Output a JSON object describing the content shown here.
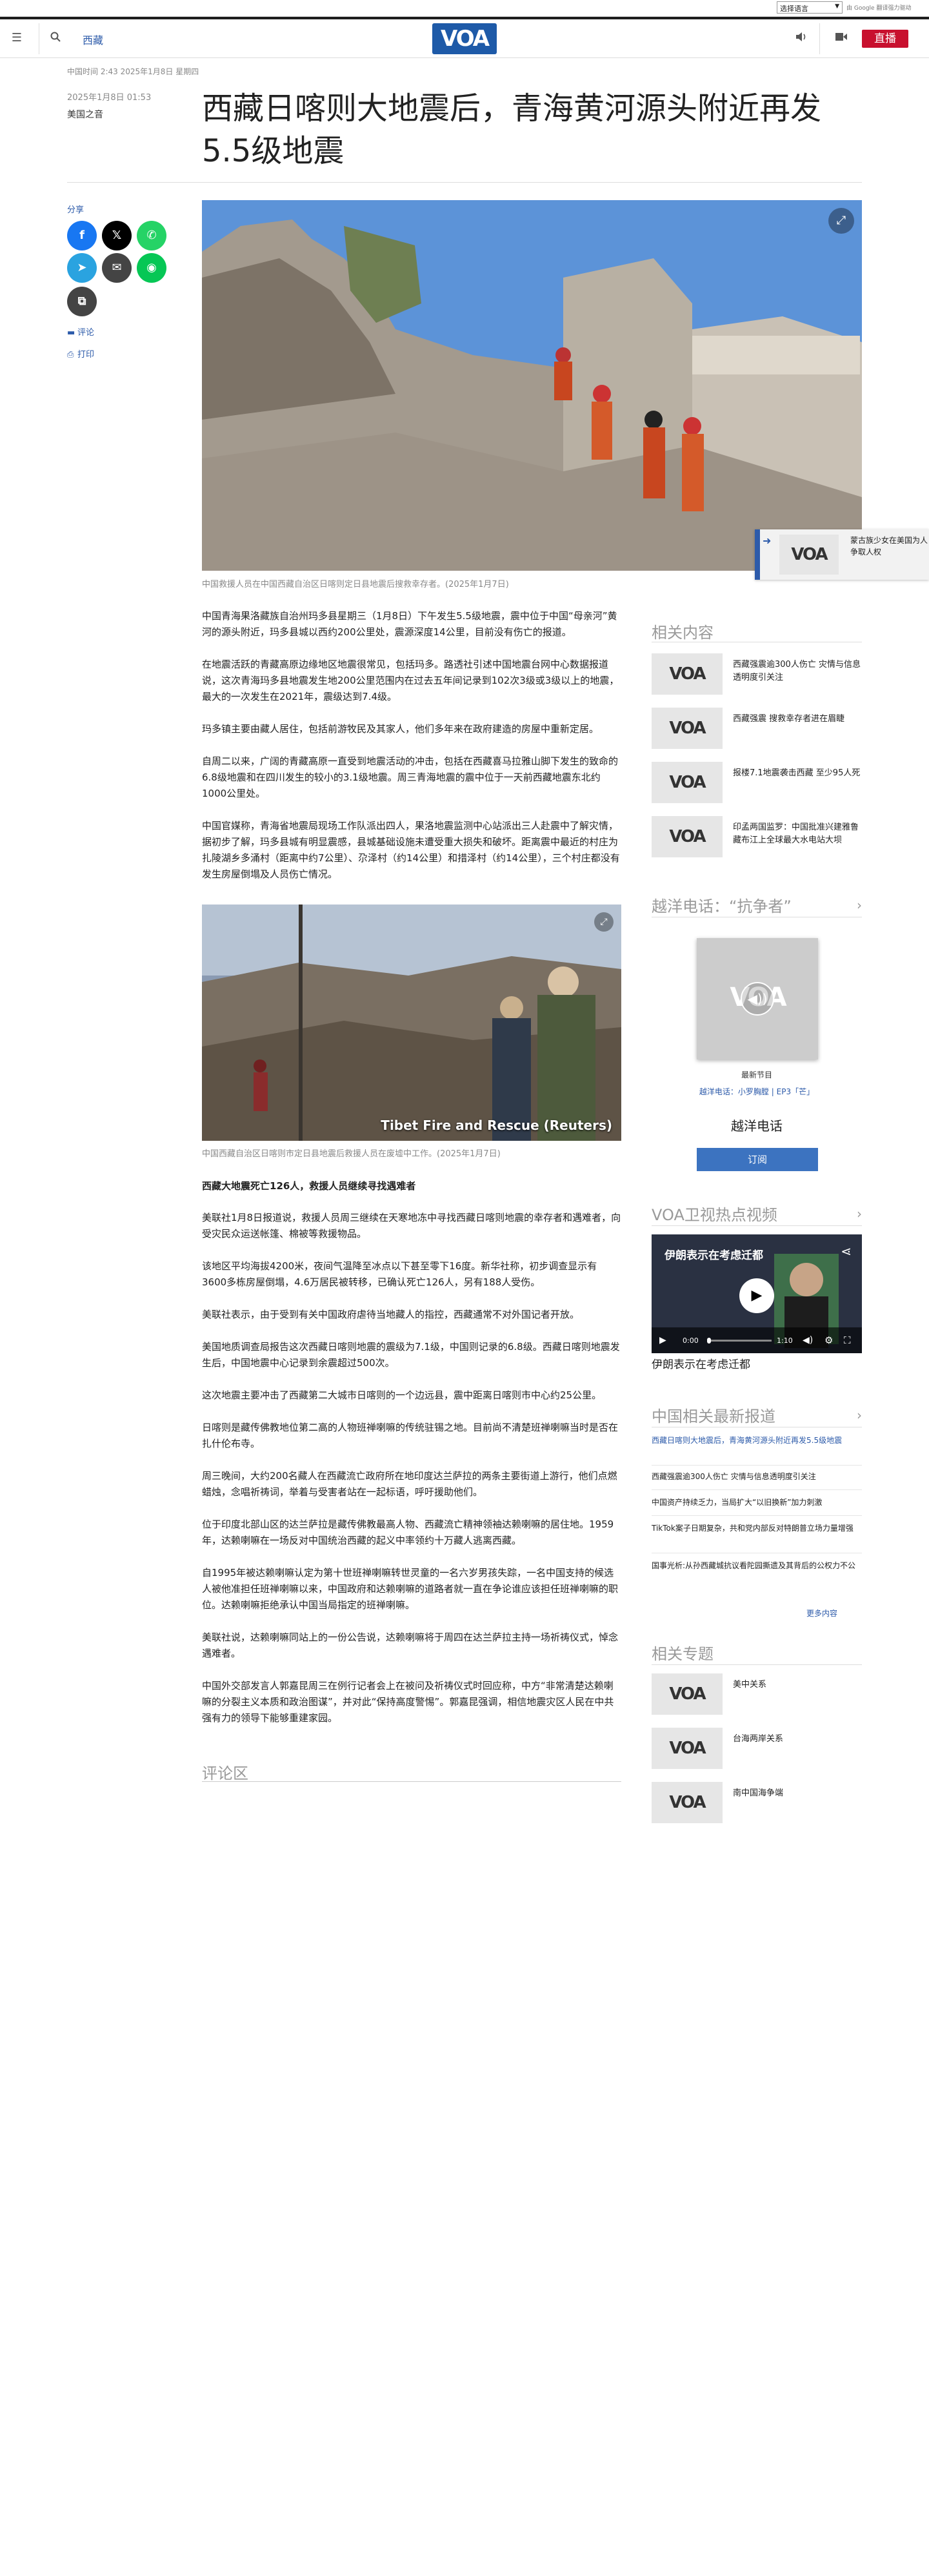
{
  "top": {
    "language_select": "选择语言",
    "google_translate": "由 Google 翻译强力驱动"
  },
  "header": {
    "section": "西藏",
    "logo": "VOA",
    "live": "直播"
  },
  "article": {
    "meta": "中国时间 2:43 2025年1月8日 星期四",
    "date": "2025年1月8日 01:53",
    "byline": "美国之音",
    "title": "西藏日喀则大地震后，青海黄河源头附近再发5.5级地震",
    "share_label": "分享",
    "comments_link": "评论",
    "print_link": "打印",
    "hero_caption": "中国救援人员在中国西藏自治区日喀则定日县地震后搜救幸存者。(2025年1月7日)",
    "paras1": [
      "中国青海果洛藏族自治州玛多县星期三（1月8日）下午发生5.5级地震，震中位于中国“母亲河”黄河的源头附近，玛多县城以西约200公里处，震源深度14公里，目前没有伤亡的报道。",
      "在地震活跃的青藏高原边缘地区地震很常见，包括玛多。路透社引述中国地震台网中心数据报道说，这次青海玛多县地震发生地200公里范围内在过去五年间记录到102次3级或3级以上的地震，最大的一次发生在2021年，震级达到7.4级。",
      "玛多镇主要由藏人居住，包括前游牧民及其家人，他们多年来在政府建造的房屋中重新定居。",
      "自周二以来，广阔的青藏高原一直受到地震活动的冲击，包括在西藏喜马拉雅山脚下发生的致命的6.8级地震和在四川发生的较小的3.1级地震。周三青海地震的震中位于一天前西藏地震东北约1000公里处。",
      "中国官媒称，青海省地震局现场工作队派出四人，果洛地震监测中心站派出三人赴震中了解灾情，据初步了解，玛多县城有明显震感，县城基础设施未遭受重大损失和破坏。距离震中最近的村庄为扎陵湖乡多涌村（距离中约7公里）、尕泽村（约14公里）和措泽村（约14公里），三个村庄都没有发生房屋倒塌及人员伤亡情况。"
    ],
    "img2_caption": "中国西藏自治区日喀则市定日县地震后救援人员在废墟中工作。(2025年1月7日)",
    "img2_overlay": "Tibet Fire and Rescue (Reuters)",
    "subhead": "西藏大地震死亡126人，救援人员继续寻找遇难者",
    "paras2": [
      "美联社1月8日报道说，救援人员周三继续在天寒地冻中寻找西藏日喀则地震的幸存者和遇难者，向受灾民众运送帐篷、棉被等救援物品。",
      "该地区平均海拔4200米，夜间气温降至冰点以下甚至零下16度。新华社称，初步调查显示有3600多栋房屋倒塌，4.6万居民被转移，已确认死亡126人，另有188人受伤。",
      "美联社表示，由于受到有关中国政府虐待当地藏人的指控，西藏通常不对外国记者开放。",
      "美国地质调查局报告这次西藏日喀则地震的震级为7.1级，中国则记录的6.8级。西藏日喀则地震发生后，中国地震中心记录到余震超过500次。",
      "这次地震主要冲击了西藏第二大城市日喀则的一个边远县，震中距离日喀则市中心约25公里。",
      "日喀则是藏传佛教地位第二高的人物班禅喇嘛的传统驻锡之地。目前尚不清楚班禅喇嘛当时是否在扎什伦布寺。",
      "周三晚间，大约200名藏人在西藏流亡政府所在地印度达兰萨拉的两条主要街道上游行，他们点燃蜡烛，念唱祈祷词，举着与受害者站在一起标语，呼吁援助他们。",
      "位于印度北部山区的达兰萨拉是藏传佛教最高人物、西藏流亡精神领袖达赖喇嘛的居住地。1959年，达赖喇嘛在一场反对中国统治西藏的起义中率领约十万藏人逃离西藏。",
      "自1995年被达赖喇嘛认定为第十世班禅喇嘛转世灵童的一名六岁男孩失踪，一名中国支持的候选人被他准担任班禅喇嘛以来，中国政府和达赖喇嘛的道路者就一直在争论谁应该担任班禅喇嘛的职位。达赖喇嘛拒绝承认中国当局指定的班禅喇嘛。",
      "美联社说，达赖喇嘛同站上的一份公告说，达赖喇嘛将于周四在达兰萨拉主持一场祈祷仪式，悼念遇难者。",
      "中国外交部发言人郭嘉昆周三在例行记者会上在被问及祈祷仪式时回应称，中方“非常清楚达赖喇嘛的分裂主义本质和政治图谋”，并对此“保持高度警惕”。郭嘉昆强调，相信地震灾区人民在中共强有力的领导下能够重建家园。"
    ],
    "comments_heading": "评论区"
  },
  "float": {
    "title": "蒙古族少女在美国为人争取人权"
  },
  "sidebar": {
    "related_heading": "相关内容",
    "related": [
      {
        "title": "西藏强震逾300人伤亡 灾情与信息透明度引关注"
      },
      {
        "title": "西藏强震 搜救幸存者进在眉睫"
      },
      {
        "title": "报楼7.1地震袭击西藏 至少95人死"
      },
      {
        "title": "印孟两国监罗：中国批准兴建雅鲁藏布江上全球最大水电站大坝"
      }
    ],
    "radio_heading": "越洋电话：“抗争者”",
    "radio_latest": "最新节目",
    "radio_episode_prefix": "越洋电话：小罗胸膛",
    "radio_episode_sep": "|",
    "radio_episode": "EP3「芒」",
    "radio_name": "越洋电话",
    "subscribe": "订阅",
    "video_heading": "VOA卫视热点视频",
    "video_title": "伊朗表示在考虑迁都",
    "video_time_start": "0:00",
    "video_time_end": "1:10",
    "video_caption": "伊朗表示在考虑迁都",
    "china_heading": "中国相关最新报道",
    "china_news": [
      "西藏日喀则大地震后，青海黄河源头附近再发5.5级地震",
      "西藏强震逾300人伤亡 灾情与信息透明度引关注",
      "中国资产持续乏力，当局扩大“以旧换新”加力刺激",
      "TikTok案子日期复杂，共和党内部反对特朗普立场力量增强",
      "国事光析:从孙西藏城抗议看陀园撕遗及其背后的公权力不公"
    ],
    "more_link": "更多内容",
    "topics_heading": "相关专题",
    "topics": [
      {
        "title": "美中关系"
      },
      {
        "title": "台海两岸关系"
      },
      {
        "title": "南中国海争端"
      }
    ]
  },
  "colors": {
    "brand_blue": "#1e5aa8",
    "link_blue": "#2d5baa",
    "live_red": "#c8102e"
  },
  "icons": [
    "menu-icon",
    "search-icon",
    "audio-icon",
    "video-icon",
    "expand-icon",
    "play-icon",
    "share-icon"
  ]
}
